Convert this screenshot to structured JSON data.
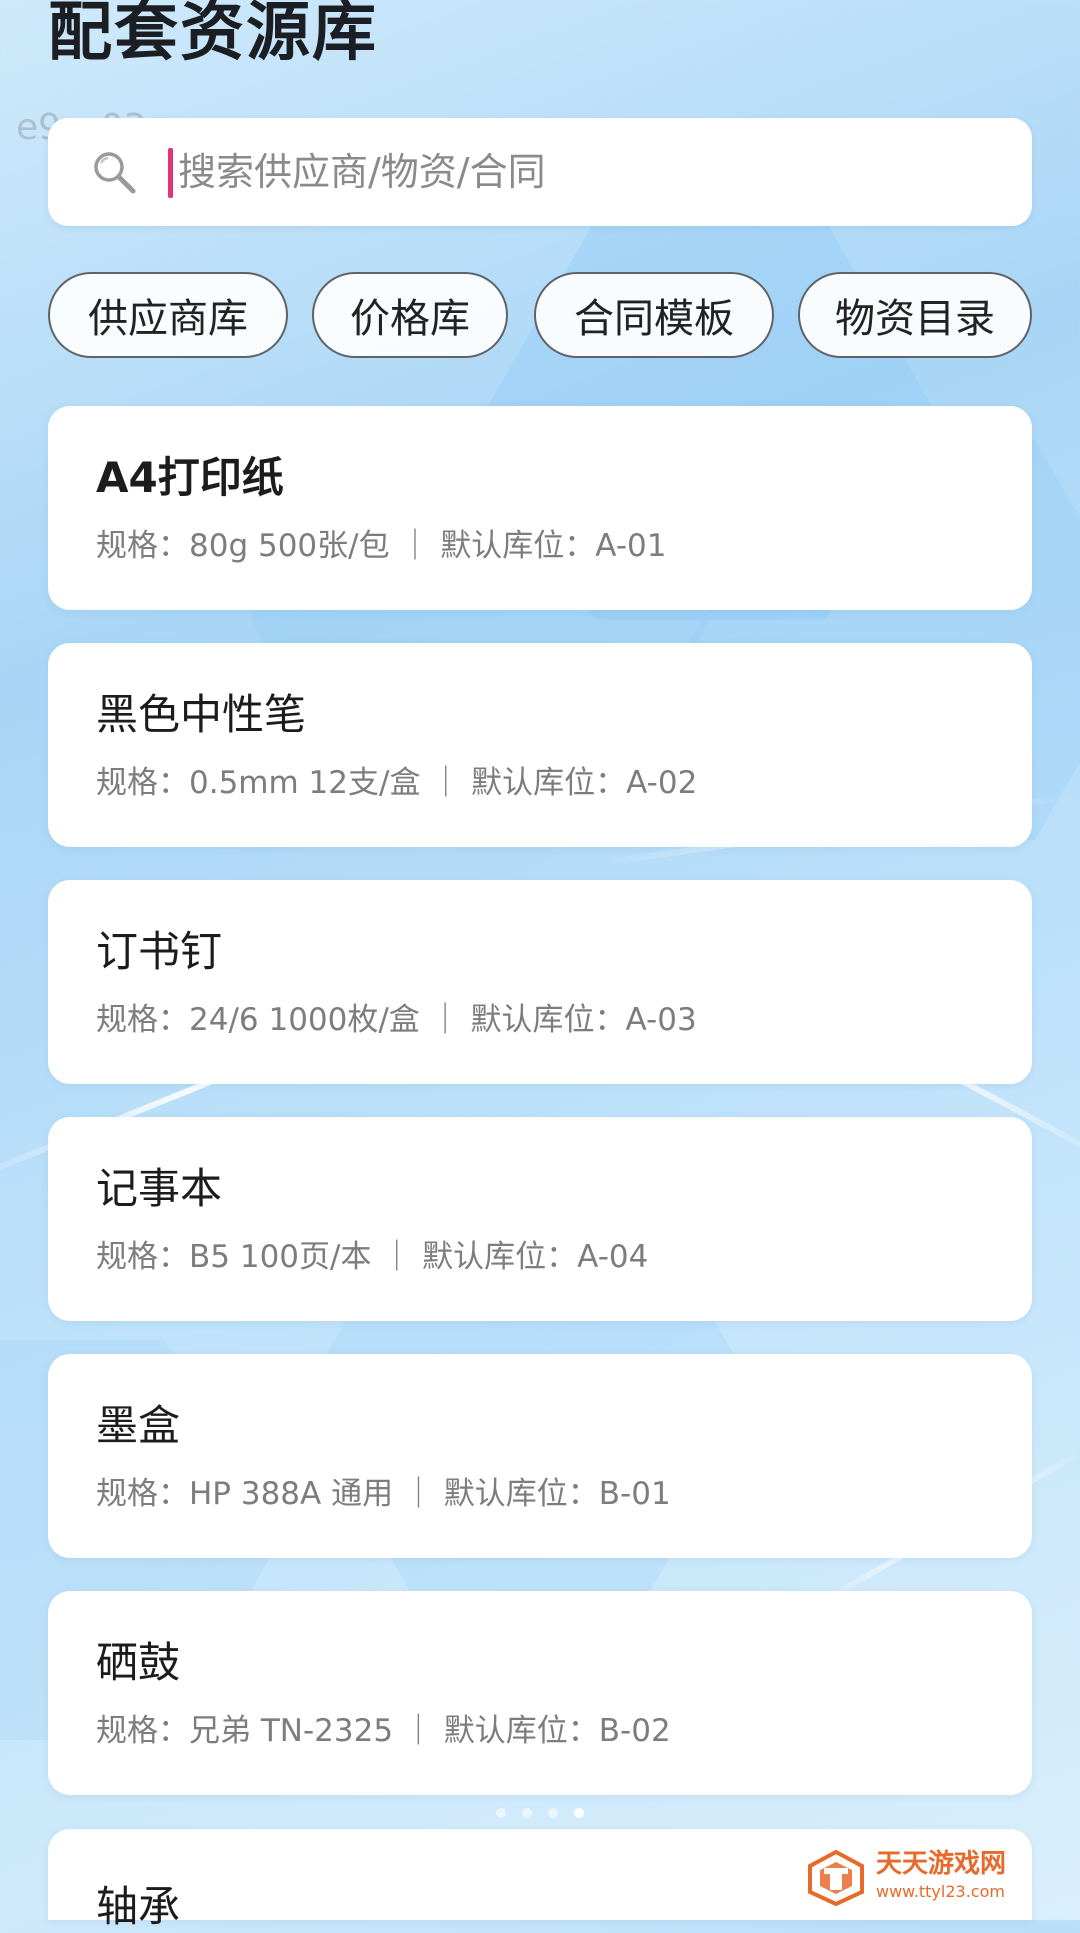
{
  "page": {
    "title": "配套资源库",
    "watermark_id": "e9cc03"
  },
  "search": {
    "placeholder": "搜索供应商/物资/合同",
    "value": "",
    "icon": "search-icon"
  },
  "categories": [
    {
      "label": "供应商库"
    },
    {
      "label": "价格库"
    },
    {
      "label": "合同模板"
    },
    {
      "label": "物资目录"
    }
  ],
  "items": [
    {
      "name": "A4打印纸",
      "meta": "规格：80g 500张/包 ｜ 默认库位：A-01"
    },
    {
      "name": "黑色中性笔",
      "meta": "规格：0.5mm 12支/盒 ｜ 默认库位：A-02"
    },
    {
      "name": "订书钉",
      "meta": "规格：24/6 1000枚/盒 ｜ 默认库位：A-03"
    },
    {
      "name": "记事本",
      "meta": "规格：B5 100页/本 ｜ 默认库位：A-04"
    },
    {
      "name": "墨盒",
      "meta": "规格：HP 388A 通用 ｜ 默认库位：B-01"
    },
    {
      "name": "硒鼓",
      "meta": "规格：兄弟 TN-2325 ｜ 默认库位：B-02"
    },
    {
      "name": "轴承",
      "meta": ""
    }
  ],
  "pager": {
    "count": 4,
    "active_index": 3
  },
  "branding": {
    "site_name": "天天游戏网",
    "site_url": "www.ttyl23.com",
    "color": "#e86a2a"
  },
  "colors": {
    "caret": "#e0337a",
    "title_text": "#1b1f24",
    "meta_text": "#7d7d7d"
  }
}
